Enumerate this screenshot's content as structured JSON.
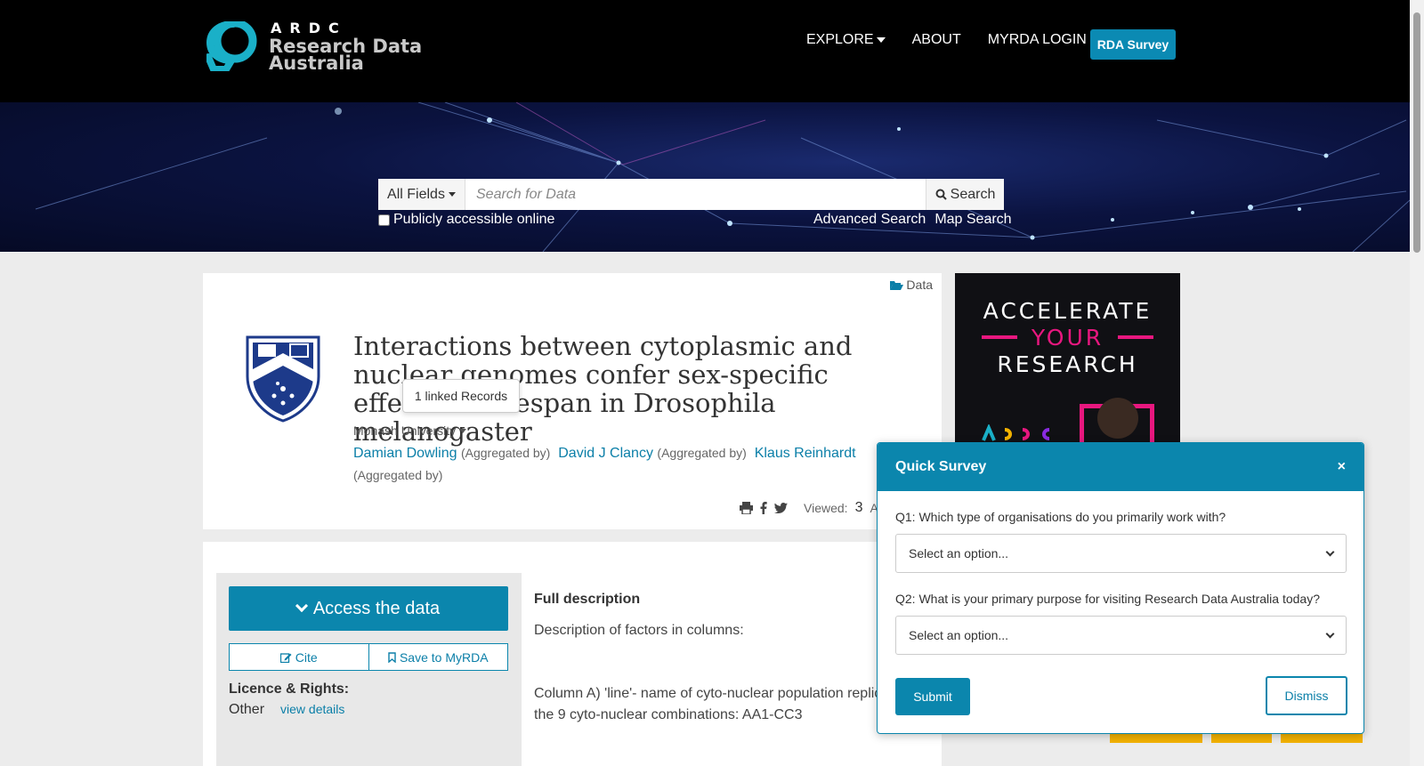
{
  "header": {
    "logo_mark": "ARDC",
    "logo_line1": "Research Data",
    "logo_line2": "Australia",
    "nav": {
      "explore": "EXPLORE",
      "about": "ABOUT",
      "login": "MYRDA LOGIN"
    },
    "survey_button": "RDA Survey"
  },
  "search": {
    "field_select": "All Fields",
    "placeholder": "Search for Data",
    "button": "Search",
    "public_checkbox": "Publicly accessible online",
    "advanced": "Advanced Search",
    "map": "Map Search"
  },
  "record": {
    "type": "Data",
    "title": "Interactions between cytoplasmic and nuclear genomes confer sex-specific effects on lifespan in Drosophila melanogaster",
    "tooltip": "1 linked Records",
    "publisher": "Monash University",
    "contributors": [
      {
        "name": "Damian Dowling",
        "role": "(Aggregated by)"
      },
      {
        "name": "David J Clancy",
        "role": "(Aggregated by)"
      },
      {
        "name": "Klaus Reinhardt",
        "role": "(Aggregated by)"
      }
    ],
    "viewed_label": "Viewed:",
    "viewed_count": "3",
    "viewed_trailing": "Ac"
  },
  "actions": {
    "access": "Access the data",
    "cite": "Cite",
    "save": "Save to MyRDA",
    "licence_heading": "Licence & Rights:",
    "licence_value": "Other",
    "licence_link": "view details"
  },
  "description": {
    "heading": "Full description",
    "line1": "Description of factors in columns:",
    "line2": "Column A) 'line'- name of cyto-nuclear population replica",
    "line3": "the 9 cyto-nuclear combinations: AA1-CC3"
  },
  "ad": {
    "line1": "ACCELERATE",
    "line2": "YOUR",
    "line3": "RESEARCH"
  },
  "survey": {
    "title": "Quick Survey",
    "close": "×",
    "q1": "Q1: Which type of organisations do you primarily work with?",
    "q1_value": "Select an option...",
    "q2": "Q2: What is your primary purpose for visiting Research Data Australia today?",
    "q2_value": "Select an option...",
    "submit": "Submit",
    "dismiss": "Dismiss"
  },
  "colors": {
    "brand_teal": "#0b86ad",
    "link": "#0b7fa8",
    "accent_pink": "#e8177f",
    "header_bg": "#000000"
  }
}
